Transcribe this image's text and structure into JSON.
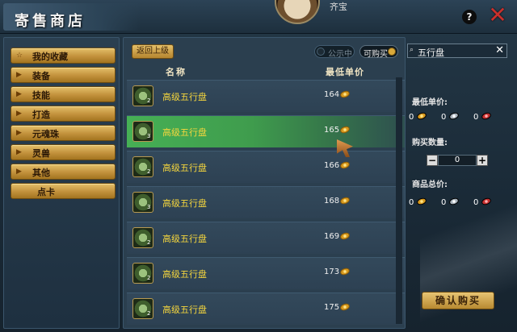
{
  "window": {
    "title": "寄售商店",
    "player_name": "齐宝",
    "help_label": "?",
    "close_label": "✕"
  },
  "sidebar": {
    "items": [
      {
        "label": "我的收藏",
        "icon": "star-icon"
      },
      {
        "label": "装备",
        "icon": "triangle-right-icon"
      },
      {
        "label": "技能",
        "icon": "triangle-right-icon"
      },
      {
        "label": "打造",
        "icon": "triangle-right-icon"
      },
      {
        "label": "元魂珠",
        "icon": "triangle-right-icon"
      },
      {
        "label": "灵兽",
        "icon": "triangle-right-icon"
      },
      {
        "label": "其他",
        "icon": "triangle-right-icon"
      },
      {
        "label": "点卡",
        "icon": ""
      }
    ]
  },
  "main": {
    "back_label": "返回上级",
    "toggle_public": "公示中",
    "toggle_buyable": "可购买",
    "col_name": "名称",
    "col_price": "最低单价",
    "rows": [
      {
        "name": "高级五行盘",
        "price": "164",
        "count": "2"
      },
      {
        "name": "高级五行盘",
        "price": "165",
        "count": "3"
      },
      {
        "name": "高级五行盘",
        "price": "166",
        "count": "2"
      },
      {
        "name": "高级五行盘",
        "price": "168",
        "count": "3"
      },
      {
        "name": "高级五行盘",
        "price": "169",
        "count": "2"
      },
      {
        "name": "高级五行盘",
        "price": "173",
        "count": "2"
      },
      {
        "name": "高级五行盘",
        "price": "175",
        "count": "2"
      }
    ],
    "selected_row": 2
  },
  "panel": {
    "search_value": "五行盘",
    "min_price_label": "最低单价:",
    "min_price": {
      "gold": "0",
      "silver": "0",
      "red": "0"
    },
    "qty_label": "购买数量:",
    "qty_value": "0",
    "total_label": "商品总价:",
    "total": {
      "gold": "0",
      "silver": "0",
      "red": "0"
    },
    "confirm_label": "确认购买"
  },
  "colors": {
    "accent_gold": "#d9a93a",
    "selected_row": "#46b055",
    "item_name": "#f5d63d"
  }
}
